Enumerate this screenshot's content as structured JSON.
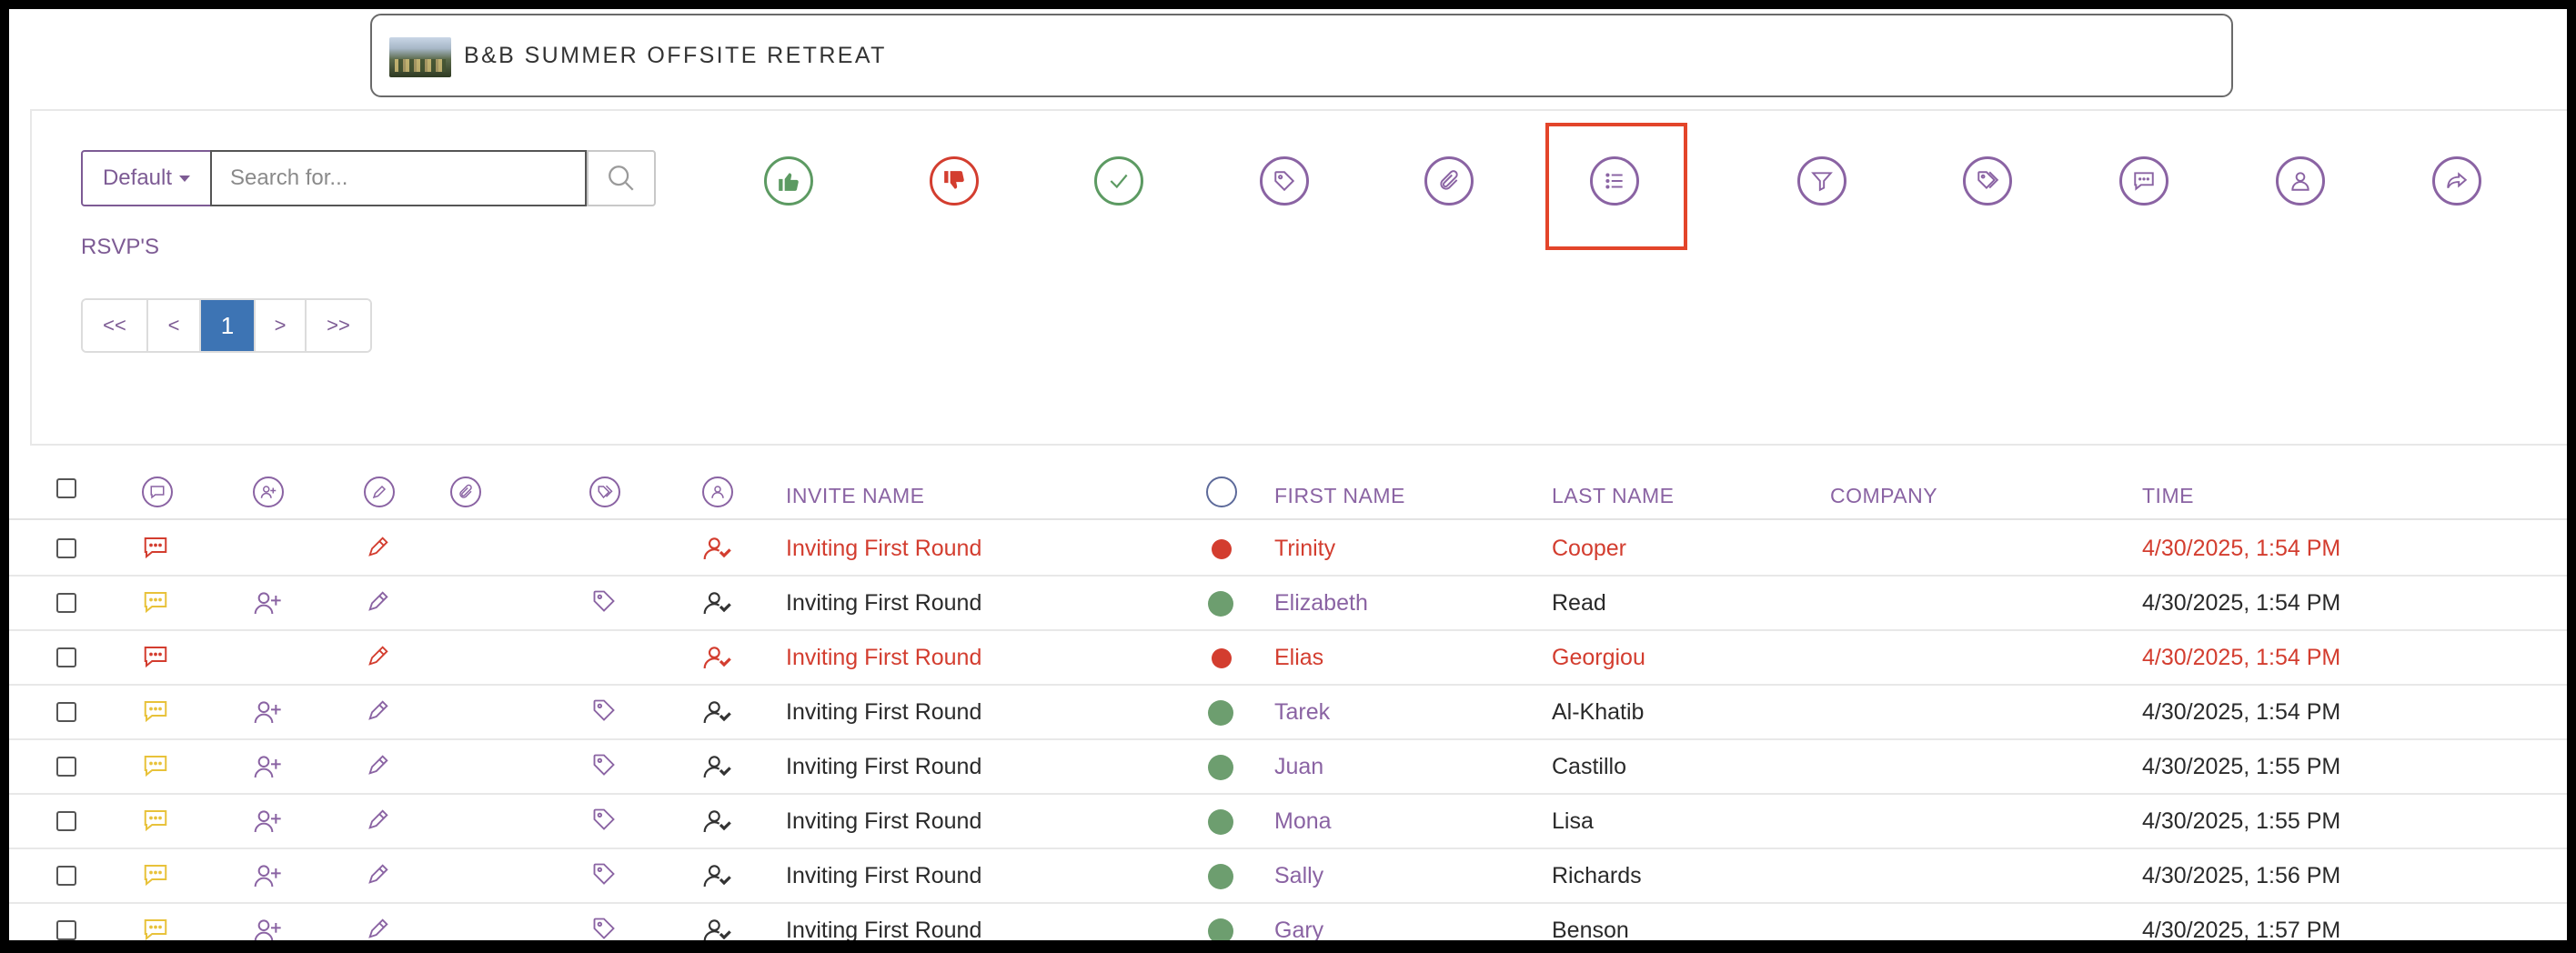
{
  "event": {
    "title": "B&B SUMMER OFFSITE RETREAT"
  },
  "toolbar": {
    "view_label": "Default",
    "search_placeholder": "Search for...",
    "section_label": "RSVP'S",
    "pagination": [
      "<<",
      "<",
      "1",
      ">",
      ">>"
    ],
    "current_page": "1",
    "actions": [
      "thumbs-up-icon",
      "thumbs-down-icon",
      "check-icon",
      "tag-icon",
      "paperclip-icon",
      "list-icon",
      "filter-icon",
      "tags-icon",
      "comment-icon",
      "user-icon",
      "share-icon"
    ]
  },
  "table": {
    "headers": {
      "invite_name": "INVITE NAME",
      "first_name": "FIRST NAME",
      "last_name": "LAST NAME",
      "company": "COMPANY",
      "time": "TIME"
    },
    "rows": [
      {
        "invite_name": "Inviting First Round",
        "status": "declined",
        "first_name": "Trinity",
        "last_name": "Cooper",
        "company": "",
        "time": "4/30/2025, 1:54 PM"
      },
      {
        "invite_name": "Inviting First Round",
        "status": "accepted",
        "first_name": "Elizabeth",
        "last_name": "Read",
        "company": "",
        "time": "4/30/2025, 1:54 PM"
      },
      {
        "invite_name": "Inviting First Round",
        "status": "declined",
        "first_name": "Elias",
        "last_name": "Georgiou",
        "company": "",
        "time": "4/30/2025, 1:54 PM"
      },
      {
        "invite_name": "Inviting First Round",
        "status": "accepted",
        "first_name": "Tarek",
        "last_name": "Al-Khatib",
        "company": "",
        "time": "4/30/2025, 1:54 PM"
      },
      {
        "invite_name": "Inviting First Round",
        "status": "accepted",
        "first_name": "Juan",
        "last_name": "Castillo",
        "company": "",
        "time": "4/30/2025, 1:55 PM"
      },
      {
        "invite_name": "Inviting First Round",
        "status": "accepted",
        "first_name": "Mona",
        "last_name": "Lisa",
        "company": "",
        "time": "4/30/2025, 1:55 PM"
      },
      {
        "invite_name": "Inviting First Round",
        "status": "accepted",
        "first_name": "Sally",
        "last_name": "Richards",
        "company": "",
        "time": "4/30/2025, 1:56 PM"
      },
      {
        "invite_name": "Inviting First Round",
        "status": "accepted",
        "first_name": "Gary",
        "last_name": "Benson",
        "company": "",
        "time": "4/30/2025, 1:57 PM"
      }
    ]
  },
  "colors": {
    "accent": "#8a63a3",
    "declined": "#d33d2f",
    "accepted": "#6d9e6f",
    "comment_open": "#e8c23a",
    "page_active": "#3d74b4",
    "highlight": "#e3452a"
  }
}
